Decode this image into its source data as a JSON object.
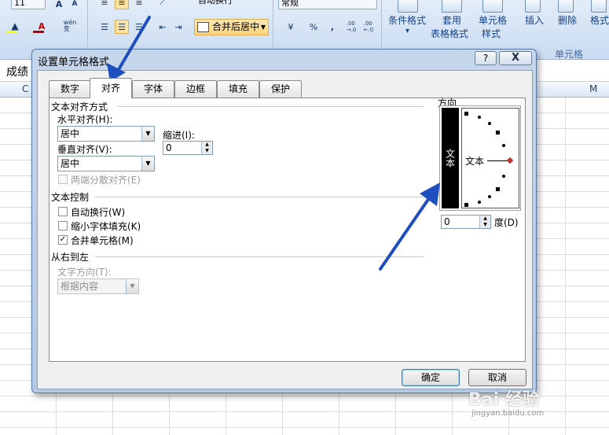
{
  "ribbon": {
    "font_size": "11",
    "font_button_a": "A",
    "font_color_a": "A",
    "wen_label": "wén\n变",
    "wrap_label": "自动换行",
    "merge_label": "合并后居中",
    "number_format": "常规",
    "percent": "%",
    "comma": ",",
    "dec_inc": ".00\n→.0",
    "dec_dec": ".00\n←.0",
    "cond_format": "条件格式",
    "table_format_1": "套用",
    "table_format_2": "表格格式",
    "cell_style_1": "单元格",
    "cell_style_2": "样式",
    "insert": "插入",
    "delete": "删除",
    "format": "格式",
    "group_cells": "单元格"
  },
  "sheet": {
    "name_cell": "成绩",
    "col_c": "C",
    "col_m": "M"
  },
  "dialog": {
    "title": "设置单元格格式",
    "help": "?",
    "close": "X",
    "tabs": [
      "数字",
      "对齐",
      "字体",
      "边框",
      "填充",
      "保护"
    ],
    "active_tab": "对齐",
    "text_align_section": "文本对齐方式",
    "horizontal_label": "水平对齐(H):",
    "horizontal_value": "居中",
    "indent_label": "缩进(I):",
    "indent_value": "0",
    "vertical_label": "垂直对齐(V):",
    "vertical_value": "居中",
    "justify_distributed": "两端分散对齐(E)",
    "text_control_section": "文本控制",
    "wrap_text": "自动换行(W)",
    "shrink_to_fit": "缩小字体填充(K)",
    "merge_cells": "合并单元格(M)",
    "rtl_section": "从右到左",
    "text_direction_label": "文字方向(T):",
    "text_direction_value": "根据内容",
    "orientation_section": "方向",
    "vertical_text": "文本",
    "orientation_text": "文本",
    "degree_value": "0",
    "degree_label": "度(D)",
    "ok": "确定",
    "cancel": "取消"
  },
  "checkboxes": {
    "justify_distributed": false,
    "wrap_text": false,
    "shrink_to_fit": false,
    "merge_cells": true
  },
  "watermark": {
    "text": "Bai 经验",
    "sub": "jingyan.baidu.com"
  },
  "colors": {
    "arrow": "#1f4fbf",
    "ribbon_text": "#15428b"
  }
}
